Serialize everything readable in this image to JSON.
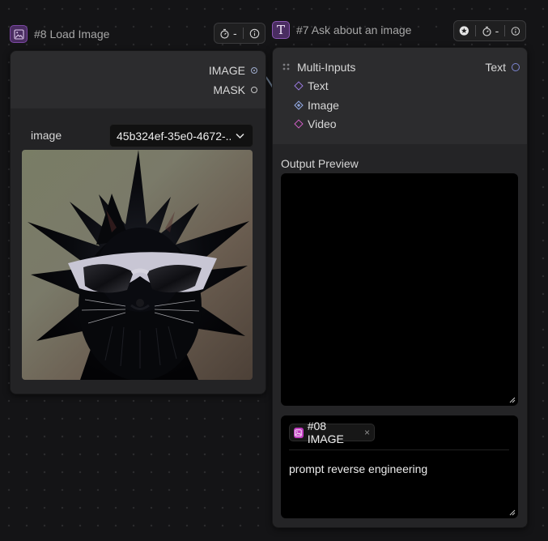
{
  "connections": {
    "wire_color": "#7b8ea6"
  },
  "load_image_node": {
    "title": "#8 Load Image",
    "toolbar": {
      "timer_value": "-"
    },
    "outputs": [
      {
        "label": "IMAGE"
      },
      {
        "label": "MASK"
      }
    ],
    "widget": {
      "label": "image",
      "value": "45b324ef-35e0-4672-..."
    },
    "preview_icon": "cat-with-sunglasses-image"
  },
  "ask_image_node": {
    "title": "#7 Ask about an image",
    "toolbar": {
      "timer_value": "-"
    },
    "inputs_group": {
      "label": "Multi-Inputs",
      "items": [
        {
          "label": "Text"
        },
        {
          "label": "Image"
        },
        {
          "label": "Video"
        }
      ]
    },
    "output": {
      "label": "Text"
    },
    "output_preview": {
      "label": "Output Preview",
      "value": ""
    },
    "prompt": {
      "tag_label": "#08 IMAGE",
      "tag_remove": "×",
      "text": "prompt reverse engineering"
    }
  }
}
